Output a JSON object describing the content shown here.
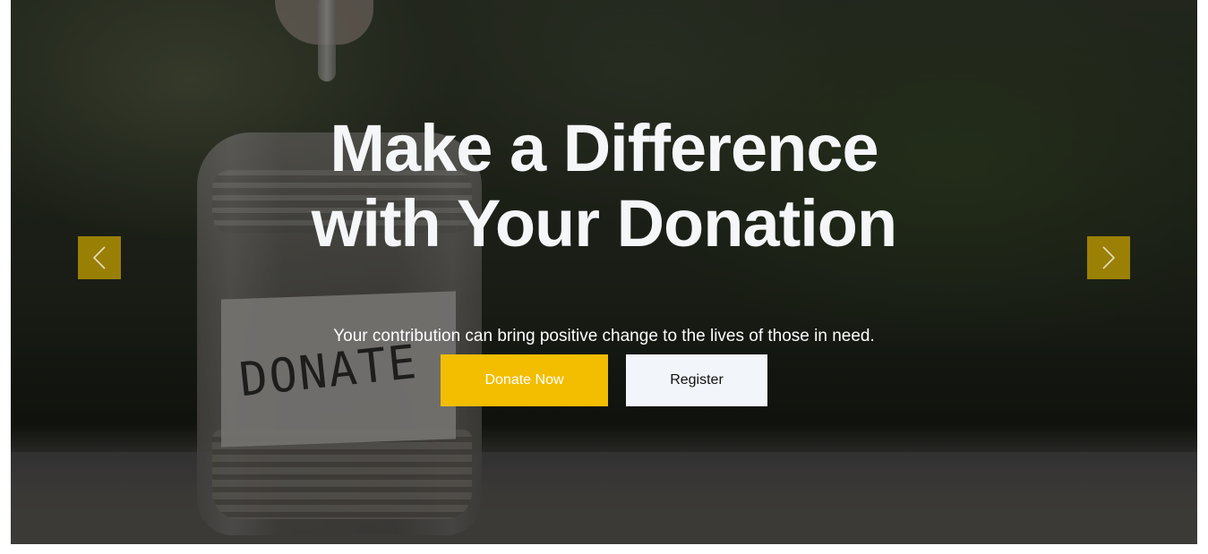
{
  "hero": {
    "headline_line1": "Make a Difference",
    "headline_line2": "with Your Donation",
    "subtitle": "Your contribution can bring positive change to the lives of those in need.",
    "background_image_label": "DONATE"
  },
  "buttons": {
    "donate_label": "Donate Now",
    "register_label": "Register"
  },
  "carousel": {
    "prev_icon": "chevron-left-icon",
    "next_icon": "chevron-right-icon"
  },
  "colors": {
    "accent": "#f3bd00",
    "secondary_button_bg": "#f2f5f9",
    "headline_text": "#f4f6f8"
  }
}
